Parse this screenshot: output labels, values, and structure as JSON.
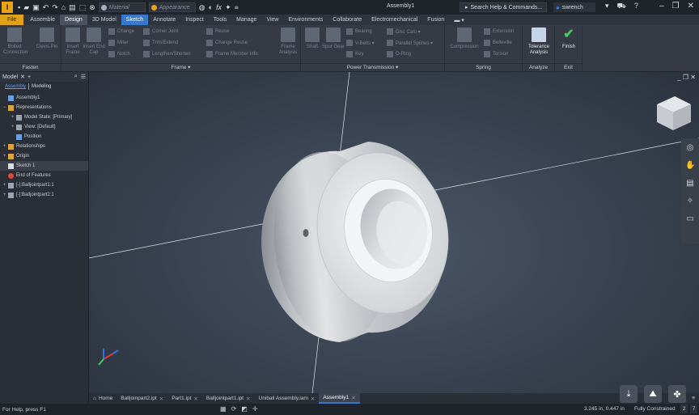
{
  "quick_access": {
    "material_placeholder": "Material",
    "appearance_placeholder": "Appearance",
    "window_title": "Assembly1",
    "help_search": "Search Help & Commands...",
    "user_name": "swrench"
  },
  "ribbon_tabs": [
    "File",
    "Assemble",
    "Design",
    "3D Model",
    "Sketch",
    "Annotate",
    "Inspect",
    "Tools",
    "Manage",
    "View",
    "Environments",
    "Collaborate",
    "Electromechanical",
    "Fusion"
  ],
  "ribbon": {
    "fasten": {
      "label": "Fasten",
      "bolted_connection": "Bolted Connection",
      "clevis_pin": "Clevis Pin"
    },
    "frame": {
      "label": "Frame ▾",
      "insert_frame": "Insert Frame",
      "insert_end_cap": "Insert End Cap",
      "change": "Change",
      "miter": "Miter",
      "notch": "Notch",
      "corner_joint": "Corner Joint",
      "trim_extend": "Trim/Extend",
      "lengthen_shorten": "Lengthen/Shorten",
      "reuse": "Reuse",
      "change_reuse": "Change Reuse",
      "frame_member_info": "Frame Member Info",
      "frame_analysis": "Frame Analysis"
    },
    "power_transmission": {
      "label": "Power Transmission ▾",
      "shaft": "Shaft",
      "spur_gear": "Spur Gear",
      "bearing": "Bearing",
      "v_belts": "V-Belts ▾",
      "key": "Key",
      "disc_cam": "Disc Cam ▾",
      "parallel_splines": "Parallel Splines ▾",
      "o_ring": "O-Ring"
    },
    "spring": {
      "label": "Spring",
      "compression": "Compression",
      "extension": "Extension",
      "belleville": "Belleville",
      "torsion": "Torsion"
    },
    "analyze": {
      "label": "Analyze",
      "tolerance_analysis": "Tolerance Analysis"
    },
    "exit": {
      "label": "Exit",
      "finish": "Finish"
    }
  },
  "browser": {
    "tab_label": "Model",
    "toggle_assembly": "Assembly",
    "toggle_modeling": "Modeling",
    "tree": [
      {
        "label": "Assembly1",
        "level": 0,
        "expander": "",
        "icon": "assembly-icon"
      },
      {
        "label": "Representations",
        "level": 0,
        "expander": "−",
        "icon": "folder-icon"
      },
      {
        "label": "Model State: [Primary]",
        "level": 1,
        "expander": "+",
        "icon": "model-state-icon"
      },
      {
        "label": "View: [Default]",
        "level": 1,
        "expander": "+",
        "icon": "eye-icon"
      },
      {
        "label": "Position",
        "level": 1,
        "expander": "",
        "icon": "position-icon"
      },
      {
        "label": "Relationships",
        "level": 0,
        "expander": "+",
        "icon": "relationships-icon"
      },
      {
        "label": "Origin",
        "level": 0,
        "expander": "+",
        "icon": "folder-icon"
      },
      {
        "label": "Sketch 1",
        "level": 0,
        "expander": "",
        "icon": "sketch-icon"
      },
      {
        "label": "End of Features",
        "level": 0,
        "expander": "",
        "icon": "stop-icon"
      },
      {
        "label": "[-]:Balljointpart1:1",
        "level": 0,
        "expander": "+",
        "icon": "part-icon"
      },
      {
        "label": "[-]:Balljointpart2:1",
        "level": 0,
        "expander": "+",
        "icon": "part-icon"
      }
    ]
  },
  "document_tabs": [
    {
      "label": "Home",
      "active": false,
      "closable": false
    },
    {
      "label": "Balljoinpart2.ipt",
      "active": false,
      "closable": true
    },
    {
      "label": "Part1.ipt",
      "active": false,
      "closable": true
    },
    {
      "label": "Balljointpart1.ipt",
      "active": false,
      "closable": true
    },
    {
      "label": "Uniball Assembly.iam",
      "active": false,
      "closable": true
    },
    {
      "label": "Assembly1",
      "active": true,
      "closable": true
    }
  ],
  "status": {
    "help_text": "For Help, press F1",
    "coordinates": "3.245 in, 0.447 in",
    "constraint_status": "Fully Constrained",
    "count_a": "2",
    "count_b": "7"
  },
  "colors": {
    "accent_blue": "#3a78c9",
    "file_tab": "#e0a21a",
    "finish_green": "#4bc760",
    "axis_red": "#e23a3a",
    "axis_green": "#3fd45a",
    "axis_blue": "#3a6ce8"
  }
}
